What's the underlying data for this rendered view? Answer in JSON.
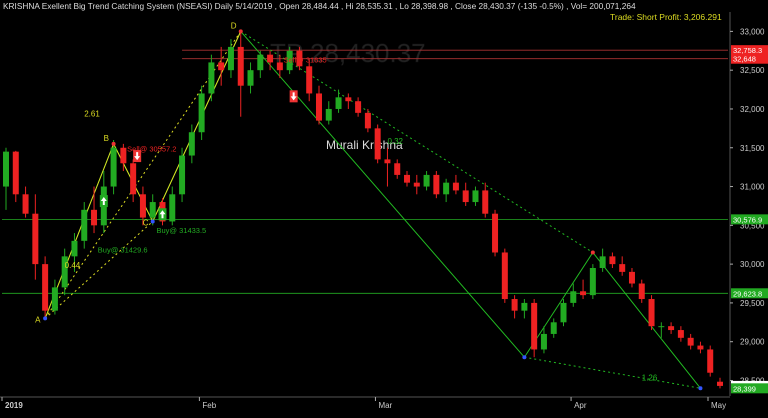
{
  "header": {
    "title": "KRISHNA Exellent Big Trend Catching System (NSEASI) Daily  5/14/2019  ,  Open 28,484.44  ,  Hi 28,535.31  ,  Lo 28,398.98  ,  Close 28,430.37 (-135 -0.5%)  ,  Vol= 200,071,264",
    "trade_label": "Trade: Short Profit: 3,206.291",
    "watermark_tp": "TP 28,430.37",
    "author": "Murali Krishna"
  },
  "colors": {
    "bg": "#000000",
    "up": "#22aa22",
    "down": "#ee2222",
    "zigzag": "#22bb22",
    "fib": "#dddd22",
    "axis": "#cccccc",
    "hline": "#22aa22",
    "sell_line": "#aa3333"
  },
  "chart_data": {
    "type": "candlestick",
    "y_ticks": [
      "33,000",
      "32,500",
      "32,000",
      "31,500",
      "31,000",
      "30,500",
      "30,000",
      "29,500",
      "29,000",
      "28,500"
    ],
    "x_labels": [
      "2019",
      "Feb",
      "Mar",
      "Apr",
      "May"
    ],
    "ylim": [
      28300,
      33250
    ],
    "price_tags": [
      {
        "text": "32,758.3",
        "value": 32758,
        "color": "#ee2222"
      },
      {
        "text": "32,648",
        "value": 32648,
        "color": "#ee2222"
      },
      {
        "text": "30,576.9",
        "value": 30577,
        "color": "#22aa22"
      },
      {
        "text": "29,623.8",
        "value": 29624,
        "color": "#22aa22"
      },
      {
        "text": "28,430.4",
        "value": 28430,
        "color": "#ffffff"
      },
      {
        "text": "28,399",
        "value": 28399,
        "color": "#22aa22"
      }
    ],
    "horizontal_lines": [
      {
        "value": 30577,
        "color": "#22aa22"
      },
      {
        "value": 29624,
        "color": "#22aa22"
      },
      {
        "value": 32758,
        "color": "#aa3333"
      },
      {
        "value": 32648,
        "color": "#aa3333"
      }
    ],
    "candles": [
      {
        "o": 31000,
        "h": 31500,
        "l": 30700,
        "c": 31450
      },
      {
        "o": 31450,
        "h": 31460,
        "l": 30800,
        "c": 30900
      },
      {
        "o": 30900,
        "h": 31000,
        "l": 30600,
        "c": 30650
      },
      {
        "o": 30650,
        "h": 30900,
        "l": 29800,
        "c": 30000
      },
      {
        "o": 30000,
        "h": 30100,
        "l": 29300,
        "c": 29400
      },
      {
        "o": 29400,
        "h": 29800,
        "l": 29350,
        "c": 29700
      },
      {
        "o": 29700,
        "h": 30200,
        "l": 29600,
        "c": 30100
      },
      {
        "o": 30100,
        "h": 30400,
        "l": 29900,
        "c": 30300
      },
      {
        "o": 30300,
        "h": 30800,
        "l": 30200,
        "c": 30700
      },
      {
        "o": 30700,
        "h": 31000,
        "l": 30400,
        "c": 30500
      },
      {
        "o": 30500,
        "h": 31200,
        "l": 30400,
        "c": 31000
      },
      {
        "o": 31000,
        "h": 31600,
        "l": 30900,
        "c": 31500
      },
      {
        "o": 31500,
        "h": 31550,
        "l": 31200,
        "c": 31300
      },
      {
        "o": 31300,
        "h": 31350,
        "l": 30800,
        "c": 30900
      },
      {
        "o": 30900,
        "h": 31000,
        "l": 30500,
        "c": 30600
      },
      {
        "o": 30600,
        "h": 30900,
        "l": 30500,
        "c": 30800
      },
      {
        "o": 30800,
        "h": 30850,
        "l": 30500,
        "c": 30550
      },
      {
        "o": 30550,
        "h": 31000,
        "l": 30500,
        "c": 30900
      },
      {
        "o": 30900,
        "h": 31500,
        "l": 30800,
        "c": 31400
      },
      {
        "o": 31400,
        "h": 31800,
        "l": 31300,
        "c": 31700
      },
      {
        "o": 31700,
        "h": 32300,
        "l": 31600,
        "c": 32200
      },
      {
        "o": 32200,
        "h": 32700,
        "l": 32100,
        "c": 32600
      },
      {
        "o": 32600,
        "h": 32800,
        "l": 32300,
        "c": 32500
      },
      {
        "o": 32500,
        "h": 32900,
        "l": 32400,
        "c": 32800
      },
      {
        "o": 32800,
        "h": 33000,
        "l": 31900,
        "c": 32300
      },
      {
        "o": 32300,
        "h": 32600,
        "l": 32200,
        "c": 32500
      },
      {
        "o": 32500,
        "h": 32750,
        "l": 32400,
        "c": 32700
      },
      {
        "o": 32700,
        "h": 32750,
        "l": 32500,
        "c": 32600
      },
      {
        "o": 32600,
        "h": 32700,
        "l": 32400,
        "c": 32500
      },
      {
        "o": 32500,
        "h": 32800,
        "l": 32450,
        "c": 32750
      },
      {
        "o": 32750,
        "h": 32800,
        "l": 32500,
        "c": 32550
      },
      {
        "o": 32550,
        "h": 32650,
        "l": 32100,
        "c": 32200
      },
      {
        "o": 32200,
        "h": 32300,
        "l": 31800,
        "c": 31850
      },
      {
        "o": 31850,
        "h": 32100,
        "l": 31800,
        "c": 32000
      },
      {
        "o": 32000,
        "h": 32250,
        "l": 31950,
        "c": 32150
      },
      {
        "o": 32150,
        "h": 32200,
        "l": 32000,
        "c": 32100
      },
      {
        "o": 32100,
        "h": 32150,
        "l": 31900,
        "c": 31950
      },
      {
        "o": 31950,
        "h": 32000,
        "l": 31700,
        "c": 31750
      },
      {
        "o": 31750,
        "h": 31800,
        "l": 31300,
        "c": 31350
      },
      {
        "o": 31350,
        "h": 31500,
        "l": 31000,
        "c": 31300
      },
      {
        "o": 31300,
        "h": 31350,
        "l": 31100,
        "c": 31150
      },
      {
        "o": 31150,
        "h": 31200,
        "l": 31000,
        "c": 31050
      },
      {
        "o": 31050,
        "h": 31150,
        "l": 30900,
        "c": 31000
      },
      {
        "o": 31000,
        "h": 31200,
        "l": 30950,
        "c": 31150
      },
      {
        "o": 31150,
        "h": 31200,
        "l": 30850,
        "c": 30900
      },
      {
        "o": 30900,
        "h": 31100,
        "l": 30800,
        "c": 31050
      },
      {
        "o": 31050,
        "h": 31150,
        "l": 30900,
        "c": 30950
      },
      {
        "o": 30950,
        "h": 31050,
        "l": 30750,
        "c": 30800
      },
      {
        "o": 30800,
        "h": 31000,
        "l": 30750,
        "c": 30950
      },
      {
        "o": 30950,
        "h": 31050,
        "l": 30600,
        "c": 30650
      },
      {
        "o": 30650,
        "h": 30700,
        "l": 30100,
        "c": 30150
      },
      {
        "o": 30150,
        "h": 30200,
        "l": 29500,
        "c": 29550
      },
      {
        "o": 29550,
        "h": 29600,
        "l": 29300,
        "c": 29400
      },
      {
        "o": 29400,
        "h": 29550,
        "l": 29300,
        "c": 29500
      },
      {
        "o": 29500,
        "h": 29550,
        "l": 28800,
        "c": 28900
      },
      {
        "o": 28900,
        "h": 29200,
        "l": 28850,
        "c": 29100
      },
      {
        "o": 29100,
        "h": 29300,
        "l": 29050,
        "c": 29250
      },
      {
        "o": 29250,
        "h": 29550,
        "l": 29200,
        "c": 29500
      },
      {
        "o": 29500,
        "h": 29750,
        "l": 29450,
        "c": 29650
      },
      {
        "o": 29650,
        "h": 29800,
        "l": 29550,
        "c": 29600
      },
      {
        "o": 29600,
        "h": 30000,
        "l": 29550,
        "c": 29950
      },
      {
        "o": 29950,
        "h": 30200,
        "l": 29900,
        "c": 30100
      },
      {
        "o": 30100,
        "h": 30150,
        "l": 29950,
        "c": 30000
      },
      {
        "o": 30000,
        "h": 30100,
        "l": 29850,
        "c": 29900
      },
      {
        "o": 29900,
        "h": 29950,
        "l": 29700,
        "c": 29750
      },
      {
        "o": 29750,
        "h": 29800,
        "l": 29500,
        "c": 29550
      },
      {
        "o": 29550,
        "h": 29600,
        "l": 29150,
        "c": 29200
      },
      {
        "o": 29200,
        "h": 29250,
        "l": 29050,
        "c": 29200
      },
      {
        "o": 29200,
        "h": 29250,
        "l": 29100,
        "c": 29150
      },
      {
        "o": 29150,
        "h": 29200,
        "l": 29000,
        "c": 29050
      },
      {
        "o": 29050,
        "h": 29100,
        "l": 28900,
        "c": 28950
      },
      {
        "o": 28950,
        "h": 29000,
        "l": 28850,
        "c": 28900
      },
      {
        "o": 28900,
        "h": 28950,
        "l": 28550,
        "c": 28600
      },
      {
        "o": 28484,
        "h": 28535,
        "l": 28399,
        "c": 28430
      }
    ],
    "zigzag_points": [
      {
        "label": "A",
        "value": 29300
      },
      {
        "label": "B",
        "value": 31550
      },
      {
        "label": "C",
        "value": 30550
      },
      {
        "label": "D",
        "value": 33000
      },
      {
        "label": "",
        "value": 28800
      },
      {
        "label": "",
        "value": 30150
      },
      {
        "label": "",
        "value": 28400
      }
    ],
    "signals": [
      {
        "text": "Buy@ 31429.6",
        "type": "buy"
      },
      {
        "text": "Buy@ 31433.5",
        "type": "buy"
      },
      {
        "text": "Sell@ 30557.2",
        "type": "sell"
      },
      {
        "text": "Sell@ 31635",
        "type": "sell"
      }
    ],
    "fib_ratios": [
      "2.61",
      "0.44",
      "0.32",
      "1.26"
    ]
  }
}
